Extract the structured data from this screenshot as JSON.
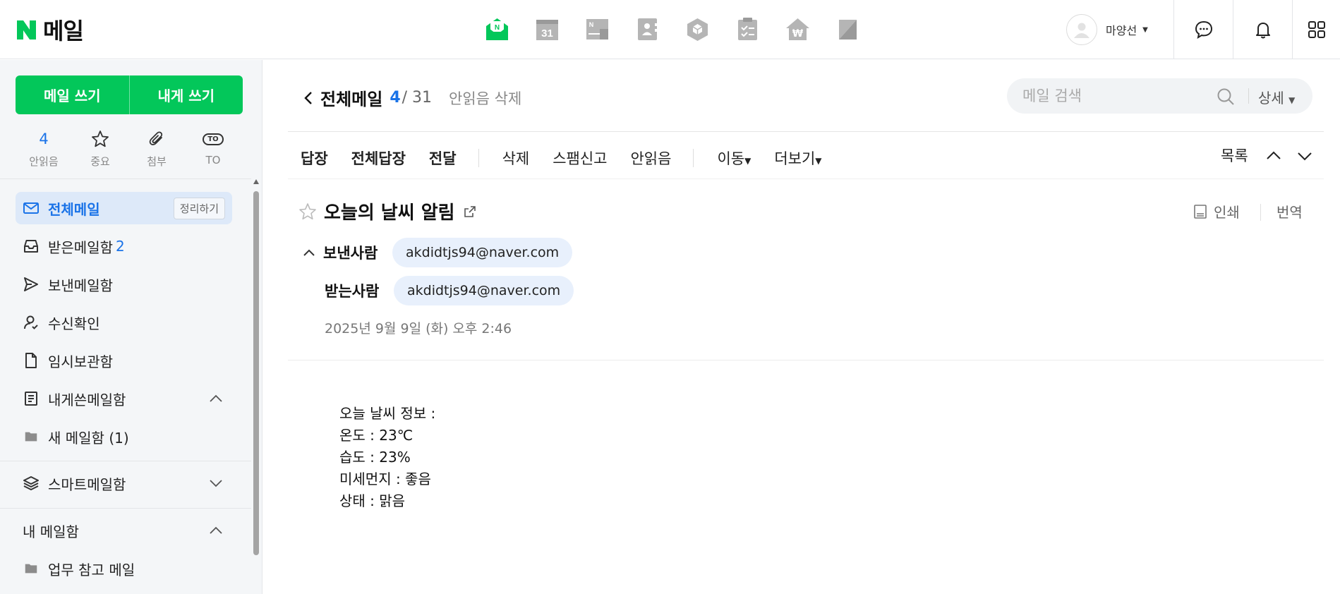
{
  "header": {
    "logo_letter": "N",
    "logo_text": "메일",
    "brand_color": "#03c75a",
    "apps": [
      {
        "name": "mail-app-icon",
        "label": "N"
      },
      {
        "name": "calendar-app-icon",
        "label": "31"
      },
      {
        "name": "note-app-icon",
        "label": "N"
      },
      {
        "name": "contacts-app-icon",
        "label": ""
      },
      {
        "name": "box-app-icon",
        "label": ""
      },
      {
        "name": "todo-app-icon",
        "label": ""
      },
      {
        "name": "pay-app-icon",
        "label": "₩"
      },
      {
        "name": "bookmark-app-icon",
        "label": ""
      }
    ],
    "username": "마양선",
    "user_caret": "▼"
  },
  "sidebar": {
    "compose_label": "메일 쓰기",
    "self_compose_label": "내게 쓰기",
    "quick": {
      "unread_count": "4",
      "unread_label": "안읽음",
      "important_label": "중요",
      "attachment_label": "첨부",
      "to_badge": "TO",
      "to_label": "TO"
    },
    "folders": {
      "all": "전체메일",
      "tidy": "정리하기",
      "inbox": "받은메일함",
      "inbox_count": "2",
      "sent": "보낸메일함",
      "receipt": "수신확인",
      "drafts": "임시보관함",
      "self": "내게쓴메일함",
      "new_box": "새 메일함 (1)",
      "smart": "스마트메일함",
      "my_boxes": "내 메일함",
      "work": "업무 참고 메일"
    }
  },
  "main": {
    "folder_title": "전체메일",
    "unread": "4",
    "total": "/ 31",
    "delete_unread": "안읽음 삭제",
    "search_placeholder": "메일 검색",
    "search_detail": "상세",
    "toolbar": {
      "reply": "답장",
      "reply_all": "전체답장",
      "forward": "전달",
      "delete": "삭제",
      "spam": "스팸신고",
      "mark_unread": "안읽음",
      "move": "이동",
      "more": "더보기",
      "list": "목록"
    },
    "mail": {
      "subject": "오늘의 날씨 알림",
      "print": "인쇄",
      "translate": "번역",
      "from_label": "보낸사람",
      "from": "akdidtjs94@naver.com",
      "to_label": "받는사람",
      "to": "akdidtjs94@naver.com",
      "date": "2025년 9월 9일 (화) 오후 2:46",
      "body": [
        "오늘 날씨 정보 :",
        "온도 : 23℃",
        "습도 : 23%",
        "미세먼지 : 좋음",
        "상태 : 맑음"
      ]
    }
  }
}
